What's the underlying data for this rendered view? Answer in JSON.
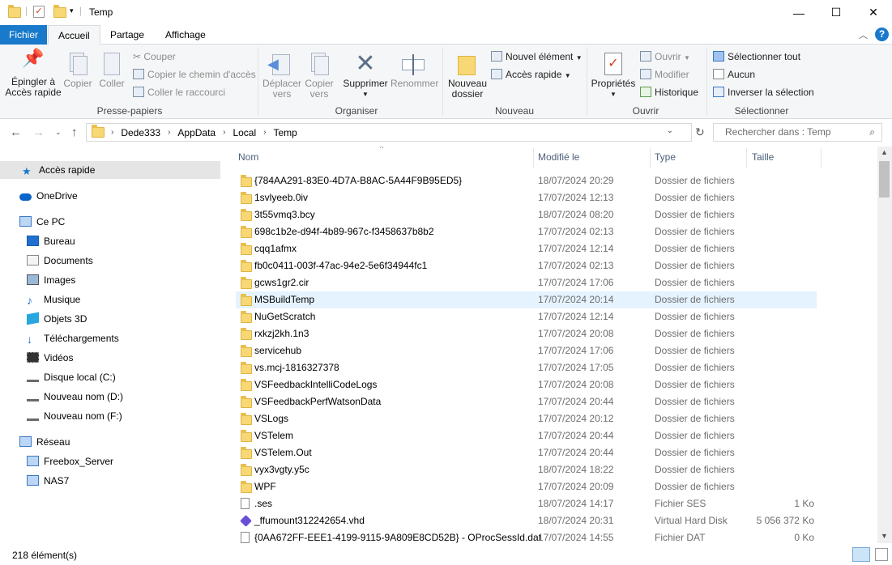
{
  "window": {
    "title": "Temp",
    "minimize": "—",
    "maximize": "☐",
    "close": "✕"
  },
  "tabs": {
    "file": "Fichier",
    "home": "Accueil",
    "share": "Partage",
    "view": "Affichage"
  },
  "ribbon": {
    "pin": "Épingler à\nAccès rapide",
    "copy": "Copier",
    "paste": "Coller",
    "cut": "Couper",
    "copy_path": "Copier le chemin d'accès",
    "paste_shortcut": "Coller le raccourci",
    "group_clipboard": "Presse-papiers",
    "move_to": "Déplacer\nvers",
    "copy_to": "Copier\nvers",
    "delete": "Supprimer",
    "rename": "Renommer",
    "group_organize": "Organiser",
    "new_folder": "Nouveau\ndossier",
    "new_item": "Nouvel élément",
    "easy_access": "Accès rapide",
    "group_new": "Nouveau",
    "properties": "Propriétés",
    "open": "Ouvrir",
    "edit": "Modifier",
    "history": "Historique",
    "group_open": "Ouvrir",
    "select_all": "Sélectionner tout",
    "select_none": "Aucun",
    "invert_selection": "Inverser la sélection",
    "group_select": "Sélectionner"
  },
  "address": {
    "crumbs": [
      "Dede333",
      "AppData",
      "Local",
      "Temp"
    ],
    "search_placeholder": "Rechercher dans : Temp"
  },
  "nav": {
    "quick_access": "Accès rapide",
    "onedrive": "OneDrive",
    "this_pc": "Ce PC",
    "desktop": "Bureau",
    "documents": "Documents",
    "pictures": "Images",
    "music": "Musique",
    "objects3d": "Objets 3D",
    "downloads": "Téléchargements",
    "videos": "Vidéos",
    "disk_c": "Disque local (C:)",
    "disk_d": "Nouveau nom (D:)",
    "disk_f": "Nouveau nom (F:)",
    "network": "Réseau",
    "freebox": "Freebox_Server",
    "nas": "NAS7"
  },
  "columns": {
    "name": "Nom",
    "modified": "Modifié le",
    "type": "Type",
    "size": "Taille"
  },
  "files": [
    {
      "name": "{784AA291-83E0-4D7A-B8AC-5A44F9B95ED5}",
      "date": "18/07/2024 20:29",
      "type": "Dossier de fichiers",
      "size": "",
      "icon": "folder"
    },
    {
      "name": "1svlyeeb.0iv",
      "date": "17/07/2024 12:13",
      "type": "Dossier de fichiers",
      "size": "",
      "icon": "folder"
    },
    {
      "name": "3t55vmq3.bcy",
      "date": "18/07/2024 08:20",
      "type": "Dossier de fichiers",
      "size": "",
      "icon": "folder"
    },
    {
      "name": "698c1b2e-d94f-4b89-967c-f3458637b8b2",
      "date": "17/07/2024 02:13",
      "type": "Dossier de fichiers",
      "size": "",
      "icon": "folder"
    },
    {
      "name": "cqq1afmx",
      "date": "17/07/2024 12:14",
      "type": "Dossier de fichiers",
      "size": "",
      "icon": "folder"
    },
    {
      "name": "fb0c0411-003f-47ac-94e2-5e6f34944fc1",
      "date": "17/07/2024 02:13",
      "type": "Dossier de fichiers",
      "size": "",
      "icon": "folder"
    },
    {
      "name": "gcws1gr2.cir",
      "date": "17/07/2024 17:06",
      "type": "Dossier de fichiers",
      "size": "",
      "icon": "folder"
    },
    {
      "name": "MSBuildTemp",
      "date": "17/07/2024 20:14",
      "type": "Dossier de fichiers",
      "size": "",
      "icon": "folder",
      "hover": true
    },
    {
      "name": "NuGetScratch",
      "date": "17/07/2024 12:14",
      "type": "Dossier de fichiers",
      "size": "",
      "icon": "folder"
    },
    {
      "name": "rxkzj2kh.1n3",
      "date": "17/07/2024 20:08",
      "type": "Dossier de fichiers",
      "size": "",
      "icon": "folder"
    },
    {
      "name": "servicehub",
      "date": "17/07/2024 17:06",
      "type": "Dossier de fichiers",
      "size": "",
      "icon": "folder"
    },
    {
      "name": "vs.mcj-1816327378",
      "date": "17/07/2024 17:05",
      "type": "Dossier de fichiers",
      "size": "",
      "icon": "folder"
    },
    {
      "name": "VSFeedbackIntelliCodeLogs",
      "date": "17/07/2024 20:08",
      "type": "Dossier de fichiers",
      "size": "",
      "icon": "folder"
    },
    {
      "name": "VSFeedbackPerfWatsonData",
      "date": "17/07/2024 20:44",
      "type": "Dossier de fichiers",
      "size": "",
      "icon": "folder"
    },
    {
      "name": "VSLogs",
      "date": "17/07/2024 20:12",
      "type": "Dossier de fichiers",
      "size": "",
      "icon": "folder"
    },
    {
      "name": "VSTelem",
      "date": "17/07/2024 20:44",
      "type": "Dossier de fichiers",
      "size": "",
      "icon": "folder"
    },
    {
      "name": "VSTelem.Out",
      "date": "17/07/2024 20:44",
      "type": "Dossier de fichiers",
      "size": "",
      "icon": "folder"
    },
    {
      "name": "vyx3vgty.y5c",
      "date": "18/07/2024 18:22",
      "type": "Dossier de fichiers",
      "size": "",
      "icon": "folder"
    },
    {
      "name": "WPF",
      "date": "17/07/2024 20:09",
      "type": "Dossier de fichiers",
      "size": "",
      "icon": "folder"
    },
    {
      "name": ".ses",
      "date": "18/07/2024 14:17",
      "type": "Fichier SES",
      "size": "1 Ko",
      "icon": "file"
    },
    {
      "name": "_ffumount312242654.vhd",
      "date": "18/07/2024 20:31",
      "type": "Virtual Hard Disk",
      "size": "5 056 372 Ko",
      "icon": "vhd"
    },
    {
      "name": "{0AA672FF-EEE1-4199-9115-9A809E8CD52B} - OProcSessId.dat",
      "date": "17/07/2024 14:55",
      "type": "Fichier DAT",
      "size": "0 Ko",
      "icon": "file"
    }
  ],
  "status": {
    "count": "218 élément(s)"
  }
}
